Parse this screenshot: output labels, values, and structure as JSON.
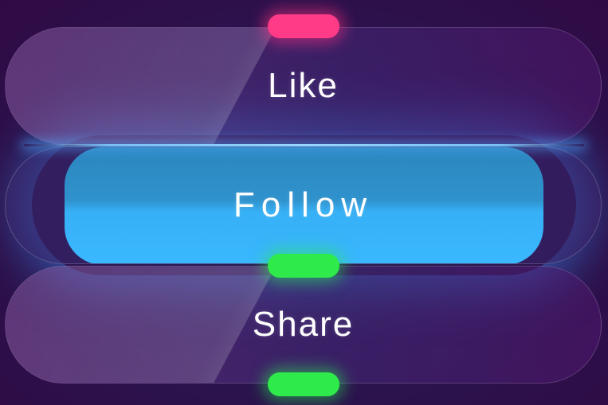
{
  "buttons": {
    "like": {
      "label": "Like"
    },
    "follow": {
      "label": "Follow",
      "state": "active"
    },
    "share": {
      "label": "Share"
    }
  },
  "indicators": {
    "top": {
      "color": "#ff3a86",
      "icon": "pink-indicator-pill"
    },
    "middle": {
      "color": "#2eea4a",
      "icon": "green-indicator-pill"
    },
    "bottom": {
      "color": "#2eea4a",
      "icon": "green-indicator-pill"
    }
  },
  "theme": {
    "background": "#2a1650",
    "accent": "#3ab8ff"
  }
}
